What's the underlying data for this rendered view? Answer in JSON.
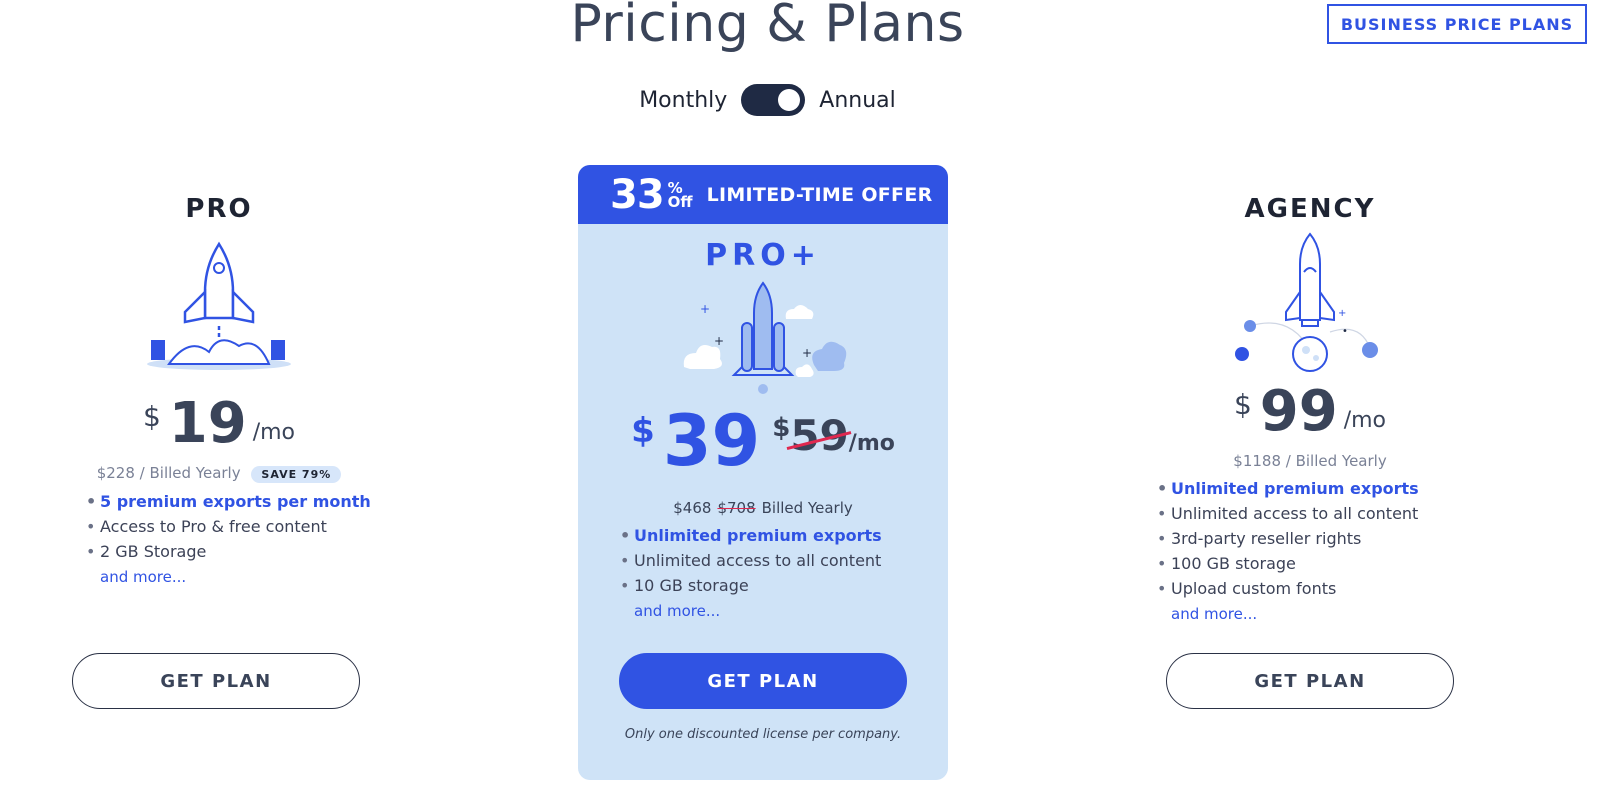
{
  "header": {
    "title": "Pricing & Plans",
    "business_button": "BUSINESS PRICE PLANS"
  },
  "billing_toggle": {
    "left_label": "Monthly",
    "right_label": "Annual",
    "selected": "Annual"
  },
  "colors": {
    "accent": "#3053e3",
    "highlight_card_bg": "#cfe3f7",
    "strike": "#e0284f",
    "toggle_bg": "#1f2a44"
  },
  "plans": {
    "pro": {
      "name": "PRO",
      "illustration": "rocket-launch-icon",
      "currency": "$",
      "price": "19",
      "period": "/mo",
      "billed": "$228 / Billed Yearly",
      "save_badge": "SAVE 79%",
      "features": [
        "5 premium exports per month",
        "Access to Pro & free content",
        "2 GB Storage"
      ],
      "more": "and more...",
      "button": "GET PLAN"
    },
    "proplus": {
      "offer_number": "33",
      "offer_pct": "%",
      "offer_off": "Off",
      "offer_text": "LIMITED-TIME OFFER",
      "name": "PRO+",
      "illustration": "rocket-clouds-icon",
      "currency": "$",
      "price": "39",
      "old_currency": "$",
      "old_price": "59",
      "period": "/mo",
      "billed_new": "$468",
      "billed_old": "$708",
      "billed_suffix": "Billed Yearly",
      "features": [
        "Unlimited premium exports",
        "Unlimited access to all content",
        "10 GB storage"
      ],
      "more": "and more...",
      "button": "GET PLAN",
      "disclaimer": "Only one discounted license per company."
    },
    "agency": {
      "name": "AGENCY",
      "illustration": "space-shuttle-planets-icon",
      "currency": "$",
      "price": "99",
      "period": "/mo",
      "billed": "$1188 / Billed Yearly",
      "features": [
        "Unlimited premium exports",
        "Unlimited access to all content",
        "3rd-party reseller rights",
        "100 GB storage",
        "Upload custom fonts"
      ],
      "more": "and more...",
      "button": "GET PLAN"
    }
  }
}
